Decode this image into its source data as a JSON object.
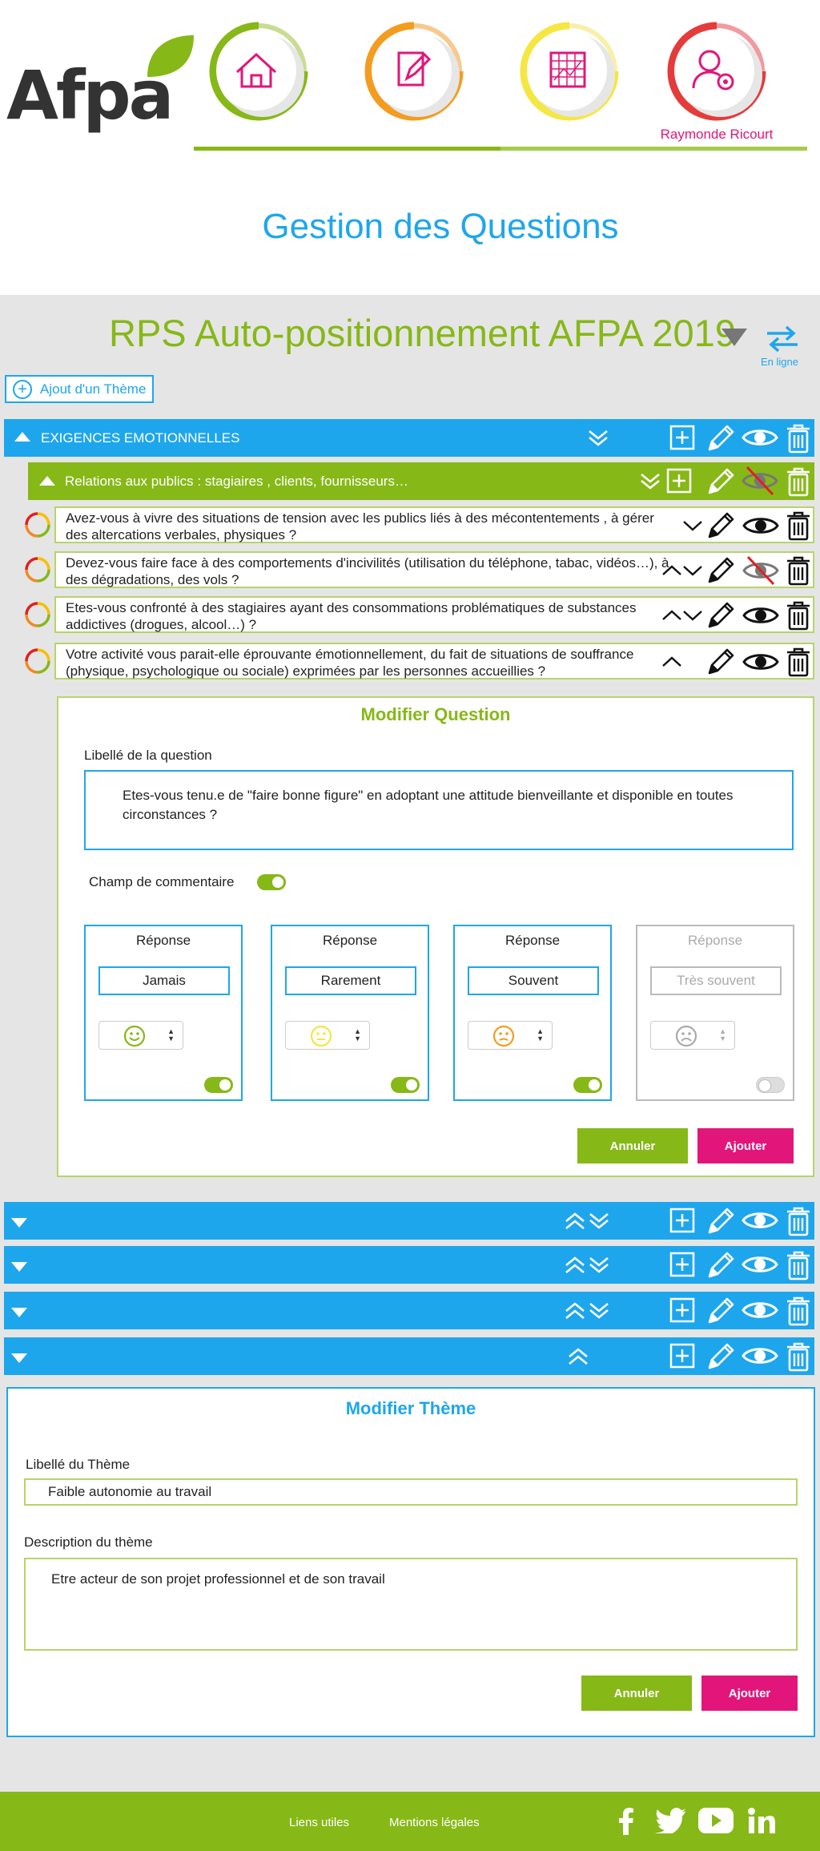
{
  "header": {
    "logo_text": "Afpa",
    "nav": [
      {
        "name": "home",
        "icon": "home-icon"
      },
      {
        "name": "edit",
        "icon": "document-edit-icon"
      },
      {
        "name": "stats",
        "icon": "chart-icon"
      },
      {
        "name": "profile",
        "icon": "user-settings-icon"
      }
    ],
    "username": "Raymonde Ricourt",
    "colors": {
      "green": "#86b817",
      "blue": "#1ea6ec",
      "pink": "#e2167a"
    }
  },
  "page_title": "Gestion des Questions",
  "survey": {
    "title": "RPS Auto-positionnement AFPA  2019",
    "status_label": "En ligne"
  },
  "add_theme_label": "Ajout d'un Thème",
  "themes": [
    {
      "label": "EXIGENCES EMOTIONNELLES",
      "sub_theme": {
        "label": "Relations aux publics : stagiaires , clients, fournisseurs…",
        "hidden": true
      },
      "questions": [
        {
          "text": "Avez-vous à vivre des situations de tension avec les publics liés à des mécontentements , à gérer des altercations verbales, physiques ?",
          "visible": true
        },
        {
          "text": "Devez-vous faire face à des comportements d'incivilités (utilisation du téléphone, tabac, vidéos…), à des dégradations, des vols ?",
          "visible": false
        },
        {
          "text": "Etes-vous confronté à des stagiaires ayant des consommations problématiques de substances addictives (drogues, alcool…) ?",
          "visible": true
        },
        {
          "text": "Votre activité vous parait-elle éprouvante émotionnellement, du fait de situations de souffrance (physique, psychologique ou sociale) exprimées par les personnes accueillies ?",
          "visible": true
        }
      ]
    }
  ],
  "edit_question": {
    "title": "Modifier Question",
    "question_label": "Libellé de la question",
    "question_value": "Etes-vous tenu.e de \"faire bonne figure\" en adoptant une attitude bienveillante et disponible en toutes circonstances ?",
    "comment_label": "Champ de commentaire",
    "comment_enabled": true,
    "responses": [
      {
        "title": "Réponse",
        "value": "Jamais",
        "icon": "happy-face-icon",
        "color": "#86b817",
        "enabled": true
      },
      {
        "title": "Réponse",
        "value": "Rarement",
        "icon": "neutral-face-icon",
        "color": "#f5e642",
        "enabled": true
      },
      {
        "title": "Réponse",
        "value": "Souvent",
        "icon": "worried-face-icon",
        "color": "#f39c1f",
        "enabled": true
      },
      {
        "title": "Réponse",
        "value": "Très souvent",
        "icon": "sad-face-icon",
        "color": "#aaaaaa",
        "enabled": false
      }
    ],
    "cancel_label": "Annuler",
    "submit_label": "Ajouter"
  },
  "collapsed_themes_count": 4,
  "edit_theme": {
    "title": "Modifier Thème",
    "label_label": "Libellé du Thème",
    "label_value": "Faible autonomie au travail",
    "description_label": "Description du thème",
    "description_value": "Etre acteur de son projet professionnel et de son travail",
    "cancel_label": "Annuler",
    "submit_label": "Ajouter"
  },
  "footer": {
    "links": [
      "Liens utiles",
      "Mentions légales"
    ],
    "social": [
      "facebook-icon",
      "twitter-icon",
      "youtube-icon",
      "linkedin-icon"
    ]
  }
}
